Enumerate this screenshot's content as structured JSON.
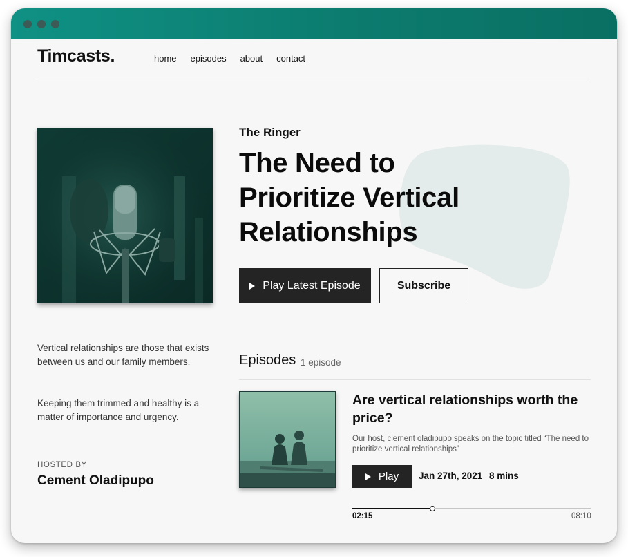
{
  "site": {
    "logo": "Timcasts.",
    "nav": [
      "home",
      "episodes",
      "about",
      "contact"
    ]
  },
  "hero": {
    "show_name": "The Ringer",
    "title_lines": [
      "The Need to",
      "Prioritize Vertical",
      "Relationships"
    ],
    "play_latest_label": "Play Latest Episode",
    "subscribe_label": "Subscribe"
  },
  "about": {
    "paragraphs": [
      "Vertical relationships are those that exists between us and our family members.",
      "Keeping them trimmed and healthy is a matter of importance and urgency."
    ],
    "hosted_by_label": "HOSTED BY",
    "host_name": "Cement Oladipupo"
  },
  "episodes": {
    "heading": "Episodes",
    "count": "1 episode",
    "items": [
      {
        "title": "Are vertical relationships worth the price?",
        "description": "Our host, clement oladipupo speaks on the topic titled “The need to prioritize vertical relationships”",
        "play_label": "Play",
        "date": "Jan 27th, 2021",
        "duration": "8 mins",
        "current_time": "02:15",
        "total_time": "08:10",
        "progress_fraction": 0.335
      }
    ]
  },
  "colors": {
    "titlebar": "#0c7c6f",
    "button_dark": "#242424",
    "blob": "#e3ecea",
    "page_bg": "#f7f7f7"
  },
  "icons": {
    "play": "play-icon",
    "window_dots": "window-control-dot",
    "cover": "microphone-image",
    "episode_thumb": "couple-on-beach-image"
  }
}
